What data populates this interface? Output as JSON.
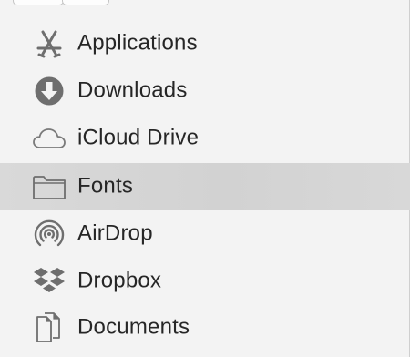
{
  "sidebar": {
    "items": [
      {
        "label": "Applications",
        "icon": "applications-icon",
        "selected": false
      },
      {
        "label": "Downloads",
        "icon": "downloads-icon",
        "selected": false
      },
      {
        "label": "iCloud Drive",
        "icon": "icloud-icon",
        "selected": false
      },
      {
        "label": "Fonts",
        "icon": "folder-icon",
        "selected": true
      },
      {
        "label": "AirDrop",
        "icon": "airdrop-icon",
        "selected": false
      },
      {
        "label": "Dropbox",
        "icon": "dropbox-icon",
        "selected": false
      },
      {
        "label": "Documents",
        "icon": "documents-icon",
        "selected": false
      }
    ]
  },
  "colors": {
    "icon": "#6e6e6e",
    "text": "#262626",
    "selected_bg": "#d4d4d4",
    "background": "#f3f3f3"
  }
}
